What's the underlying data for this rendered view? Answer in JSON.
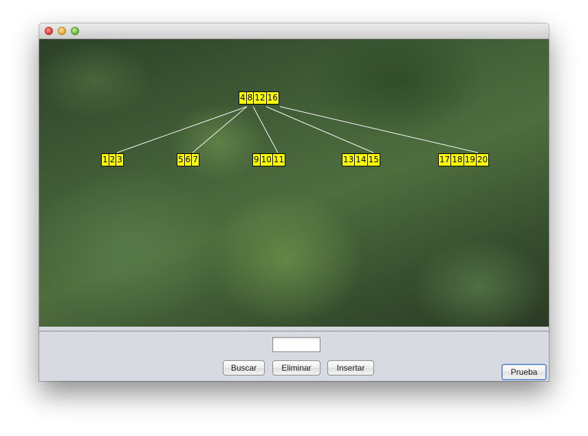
{
  "window": {
    "title": "",
    "controls": [
      "close",
      "minimize",
      "zoom"
    ]
  },
  "tree": {
    "root": {
      "keys": [
        "4",
        "8",
        "12",
        "16"
      ]
    },
    "children": [
      {
        "keys": [
          "1",
          "2",
          "3"
        ]
      },
      {
        "keys": [
          "5",
          "6",
          "7"
        ]
      },
      {
        "keys": [
          "9",
          "10",
          "11"
        ]
      },
      {
        "keys": [
          "13",
          "14",
          "15"
        ]
      },
      {
        "keys": [
          "17",
          "18",
          "19",
          "20"
        ]
      }
    ],
    "key_fill_color": "#ffff00",
    "edge_color": "#ffffff"
  },
  "input": {
    "value": "",
    "placeholder": ""
  },
  "buttons": {
    "buscar": "Buscar",
    "eliminar": "Eliminar",
    "insertar": "Insertar",
    "prueba": "Prueba"
  }
}
